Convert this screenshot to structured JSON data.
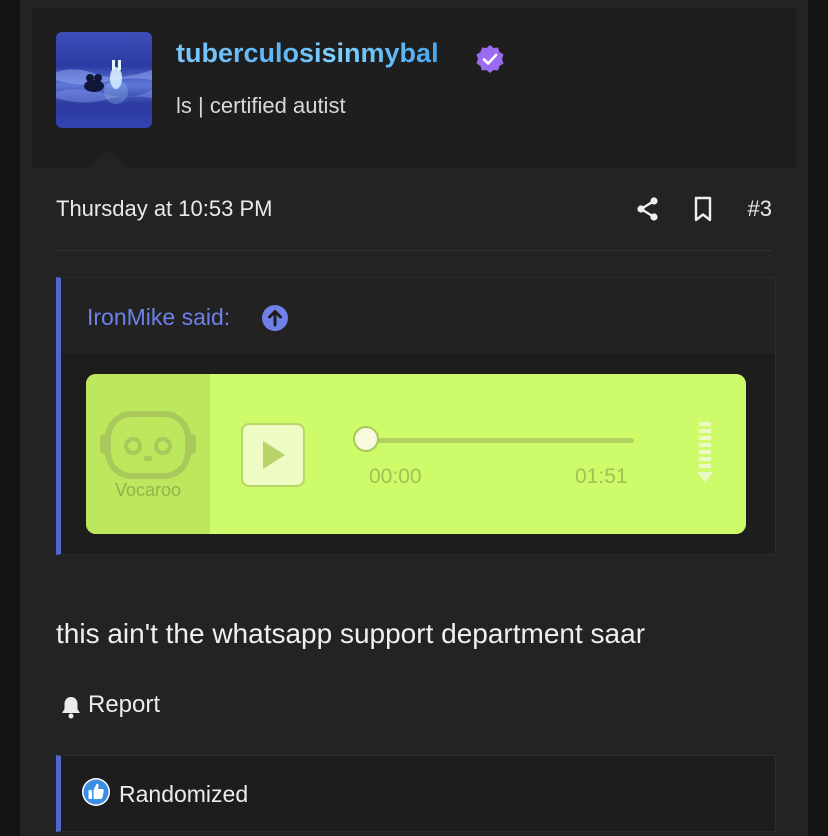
{
  "user": {
    "username": "tuberculosisinmybal",
    "title": "ls | certified autist"
  },
  "post": {
    "date": "Thursday at 10:53 PM",
    "number": "#3",
    "body": "this ain't the whatsapp support department saar"
  },
  "quote": {
    "author_label": "IronMike said:"
  },
  "vocaroo": {
    "brand": "Vocaroo",
    "current_time": "00:00",
    "total_time": "01:51",
    "progress": 0
  },
  "actions": {
    "report_label": "Report"
  },
  "reactions": {
    "users": "Randomized"
  },
  "colors": {
    "accent": "#5566cc",
    "verified": "#9b6cf0",
    "like": "#3a8fe0",
    "vocaroo_bg": "#cdfb6a"
  },
  "icons": [
    "verified-badge-icon",
    "share-icon",
    "bookmark-icon",
    "arrow-up-circle-icon",
    "vocaroo-logo-icon",
    "play-icon",
    "download-icon",
    "bell-icon",
    "like-icon"
  ]
}
